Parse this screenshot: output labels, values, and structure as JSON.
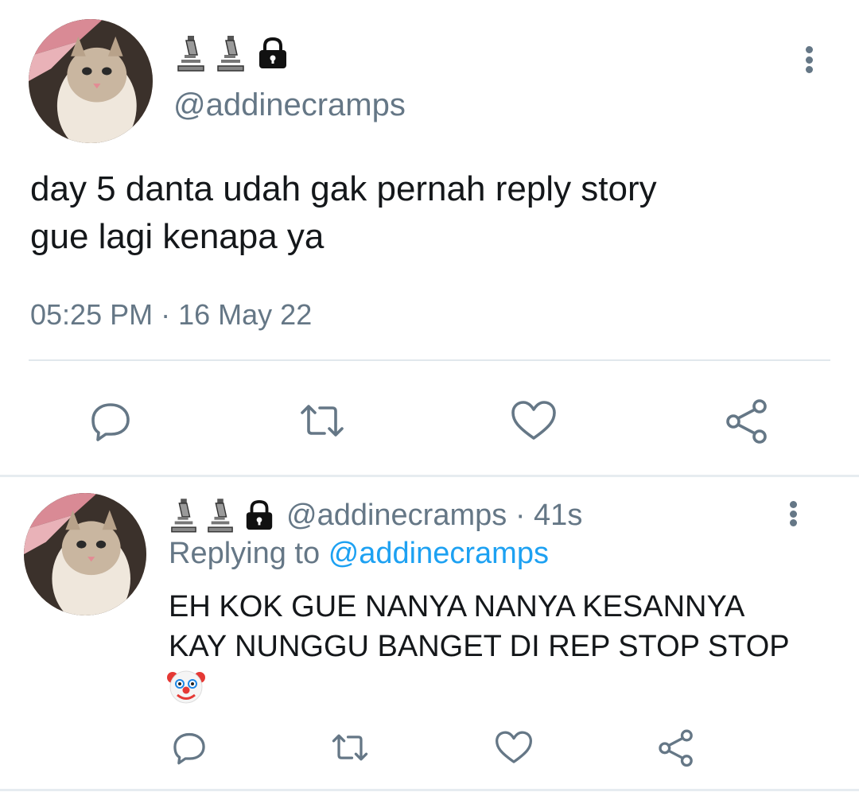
{
  "tweet": {
    "handle": "@addinecramps",
    "badge_icons": [
      "microscope-icon",
      "microscope-icon",
      "lock-icon"
    ],
    "text_line1": "day 5 danta udah gak pernah reply story",
    "text_line2": "gue lagi kenapa ya",
    "time": "05:25 PM",
    "separator": "·",
    "date": "16 May 22",
    "actions": [
      "reply-icon",
      "retweet-icon",
      "like-icon",
      "share-icon"
    ]
  },
  "reply": {
    "handle": "@addinecramps",
    "separator": "·",
    "age": "41s",
    "replying_prefix": "Replying to",
    "replying_to": "@addinecramps",
    "text_line1": "EH KOK GUE NANYA NANYA KESANNYA",
    "text_line2": "KAY NUNGGU BANGET DI REP STOP STOP",
    "emoji": "clown-face-icon",
    "actions": [
      "reply-icon",
      "retweet-icon",
      "like-icon",
      "share-icon"
    ]
  },
  "colors": {
    "text": "#14171a",
    "secondary": "#657786",
    "link": "#1da1f2",
    "divider": "#e1e8ed"
  }
}
